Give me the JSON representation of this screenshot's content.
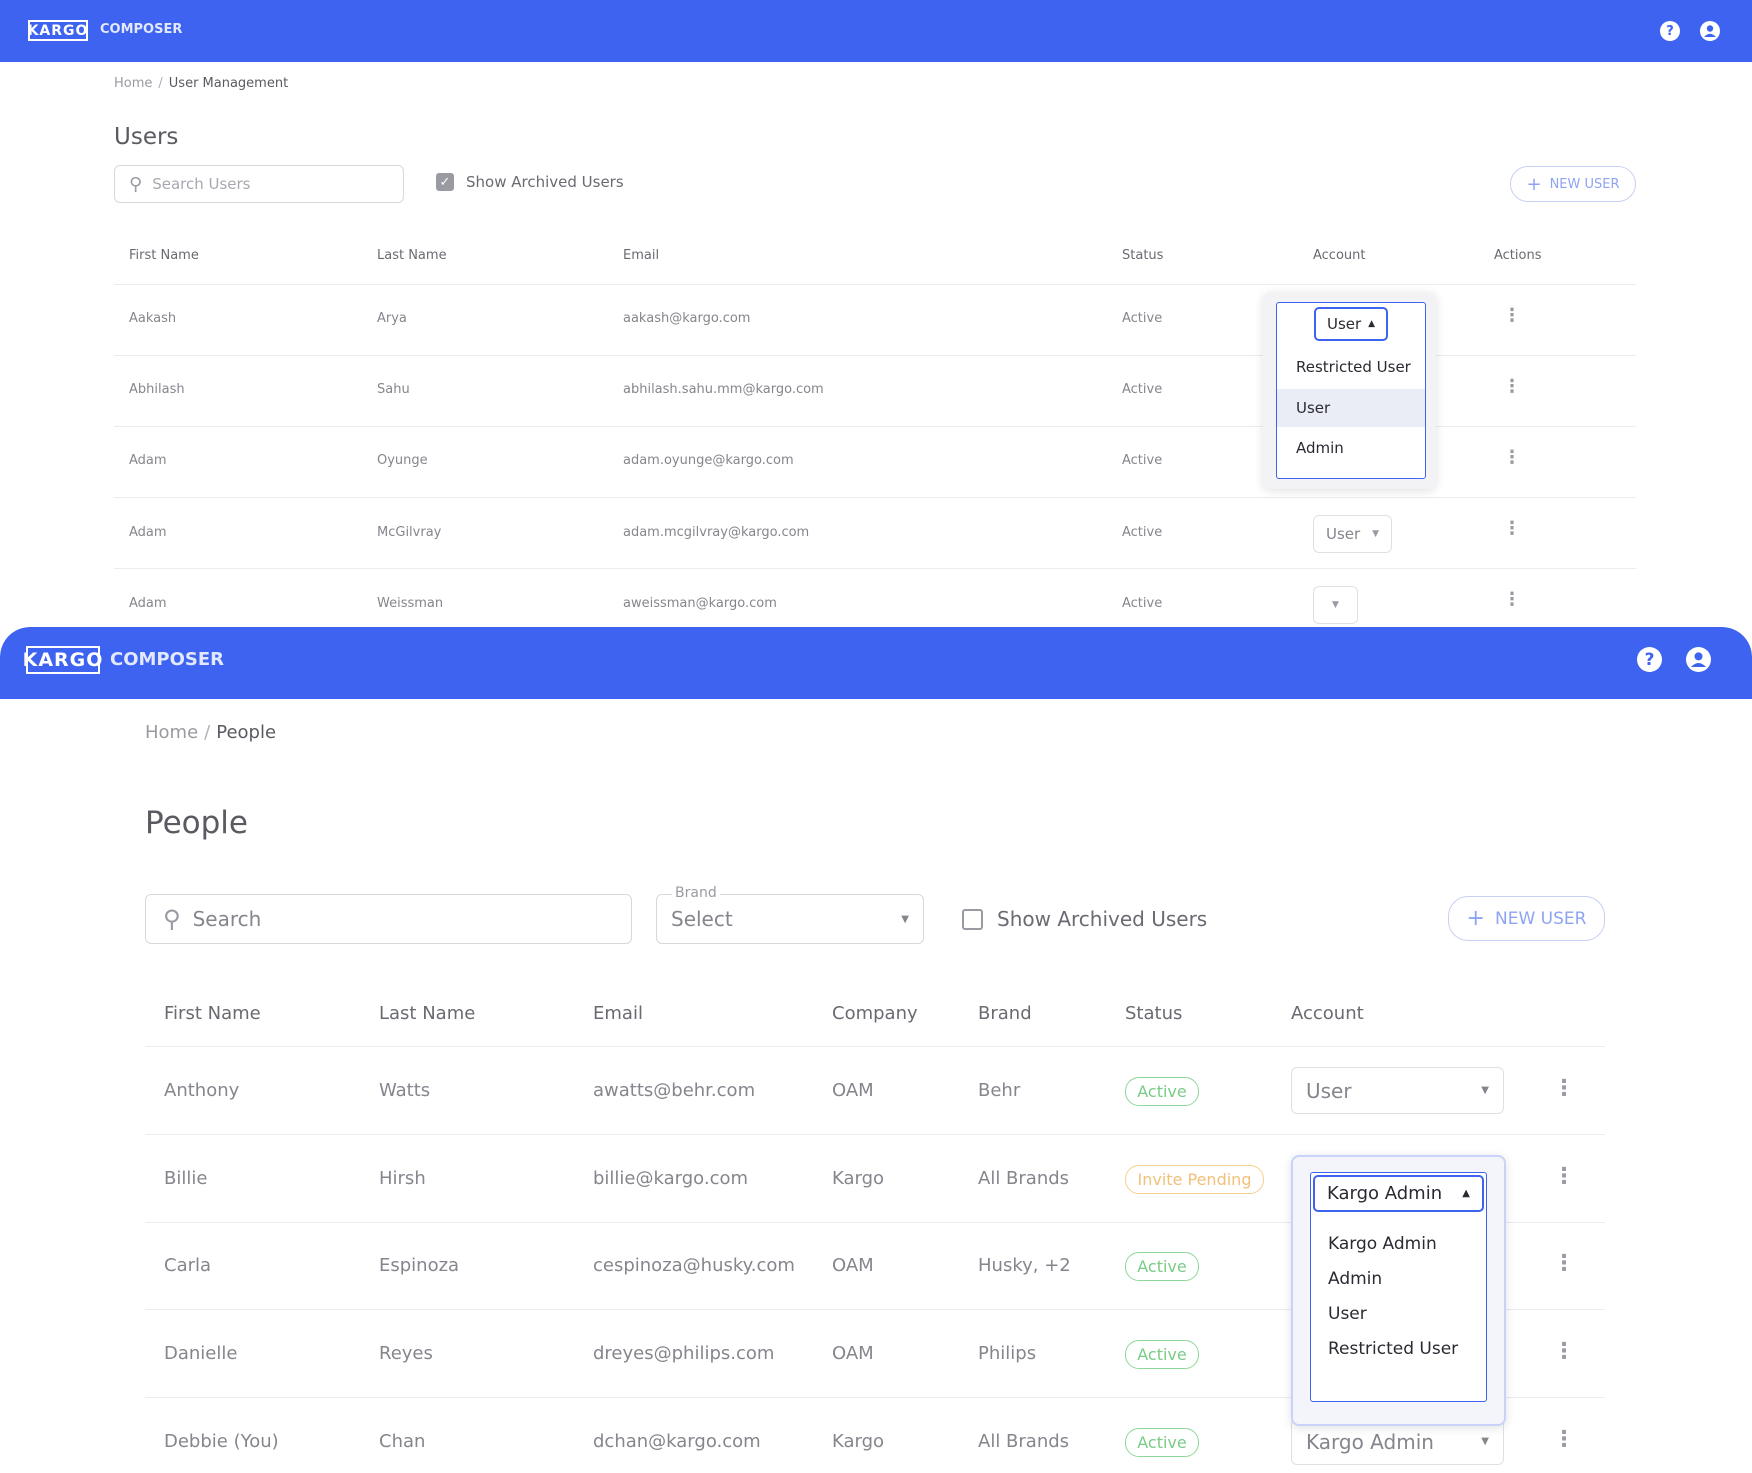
{
  "app": {
    "logo": "KARGO",
    "name": "COMPOSER",
    "help_icon": "help-icon",
    "account_icon": "account-icon"
  },
  "top": {
    "breadcrumb": {
      "home": "Home",
      "current": "User Management"
    },
    "title": "Users",
    "search": {
      "placeholder": "Search Users"
    },
    "show_archived": {
      "label": "Show Archived Users",
      "checked": true
    },
    "new_user": "NEW USER",
    "columns": [
      "First Name",
      "Last Name",
      "Email",
      "Status",
      "Account",
      "Actions"
    ],
    "rows": [
      {
        "first": "Aakash",
        "last": "Arya",
        "email": "aakash@kargo.com",
        "status": "Active",
        "account": "User"
      },
      {
        "first": "Abhilash",
        "last": "Sahu",
        "email": "abhilash.sahu.mm@kargo.com",
        "status": "Active",
        "account": ""
      },
      {
        "first": "Adam",
        "last": "Oyunge",
        "email": "adam.oyunge@kargo.com",
        "status": "Active",
        "account": ""
      },
      {
        "first": "Adam",
        "last": "McGilvray",
        "email": "adam.mcgilvray@kargo.com",
        "status": "Active",
        "account": "User"
      },
      {
        "first": "Adam",
        "last": "Weissman",
        "email": "aweissman@kargo.com",
        "status": "Active",
        "account": ""
      }
    ],
    "open_menu": {
      "selected": "User",
      "options": [
        "Restricted User",
        "User",
        "Admin"
      ]
    }
  },
  "bottom": {
    "breadcrumb": {
      "home": "Home",
      "current": "People"
    },
    "title": "People",
    "search": {
      "placeholder": "Search"
    },
    "brand_filter": {
      "label": "Brand",
      "value": "Select"
    },
    "show_archived": {
      "label": "Show Archived Users",
      "checked": false
    },
    "new_user": "NEW USER",
    "columns": [
      "First Name",
      "Last Name",
      "Email",
      "Company",
      "Brand",
      "Status",
      "Account"
    ],
    "rows": [
      {
        "first": "Anthony",
        "last": "Watts",
        "email": "awatts@behr.com",
        "company": "OAM",
        "brand": "Behr",
        "status": "Active",
        "account": "User"
      },
      {
        "first": "Billie",
        "last": "Hirsh",
        "email": "billie@kargo.com",
        "company": "Kargo",
        "brand": "All Brands",
        "status": "Invite Pending",
        "account": "Kargo Admin"
      },
      {
        "first": "Carla",
        "last": "Espinoza",
        "email": "cespinoza@husky.com",
        "company": "OAM",
        "brand": "Husky, +2",
        "status": "Active",
        "account": ""
      },
      {
        "first": "Danielle",
        "last": "Reyes",
        "email": "dreyes@philips.com",
        "company": "OAM",
        "brand": "Philips",
        "status": "Active",
        "account": ""
      },
      {
        "first": "Debbie (You)",
        "last": "Chan",
        "email": "dchan@kargo.com",
        "company": "Kargo",
        "brand": "All Brands",
        "status": "Active",
        "account": "Kargo Admin"
      }
    ],
    "open_menu": {
      "selected": "Kargo Admin",
      "options": [
        "Kargo Admin",
        "Admin",
        "User",
        "Restricted User"
      ]
    }
  },
  "colors": {
    "brand_blue": "#3d63f0",
    "active_green": "#7acb86",
    "pending_orange": "#f1c07a"
  }
}
